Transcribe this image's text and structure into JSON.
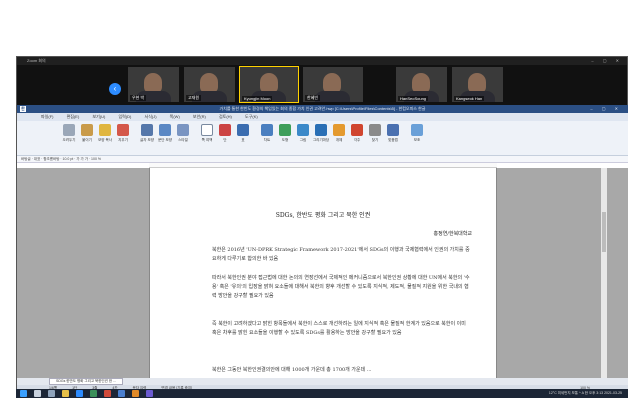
{
  "zoom": {
    "title": "Zoom 회의"
  },
  "gallery": {
    "participants": [
      {
        "name": "우현 박"
      },
      {
        "name": "고재원"
      },
      {
        "name": "Kyungjin Moon"
      },
      {
        "name": "한혜빈"
      },
      {
        "name": "HanSeoSoung"
      },
      {
        "name": "Kangseok Han"
      }
    ]
  },
  "hwp": {
    "title": "가치를 통한 한반도 환경의 책임있는 회의 종합 가치 인권 고려안.hwp [C:\\Users\\Profile\\Files\\Contents\\5] - 한컴오피스 한글",
    "menu": [
      "파일(F)",
      "편집(E)",
      "보기(U)",
      "입력(D)",
      "서식(J)",
      "쪽(W)",
      "보안(R)",
      "검토(H)",
      "도구(K)"
    ],
    "ribbon": [
      "오려두기",
      "붙이기",
      "모양 복사",
      "지우기",
      "글자 모양",
      "문단 모양",
      "스타일",
      "쪽 여백",
      "단",
      "표",
      "차트",
      "도형",
      "그림",
      "그리기마당",
      "개체",
      "각주",
      "찾기",
      "맞춤법",
      "보조"
    ],
    "format_bar": "바탕글  ·  대표  ·  함초롬바탕  ·  10.0 pt  ·  가  가  가  ·  100 %",
    "document": {
      "title": "SDGs, 한반도 평화 그리고 북한 인권",
      "author": "홍정연/한북대학교",
      "paragraphs": [
        "북한은 2016년 'UN-DPRK Strategic Framework 2017-2021'에서 SDGs의 이행과 국제협력에서 인권의 가치를 중요하게 다루기로 합의한 바 있음",
        "따라서 북한인권 분야 접근법에 대한 논의의 연장선에서 국제적인 메커니즘으로서 북한인권 상황에 대한 UN에서 북한의 '수용' 혹은 '유의'의 입장을 밝혀 요소들에 대해서 북한의 향후 개선할 수 있도록 지식적, 제도적, 물질적 지원을 위한 국내의 협력 방안을 강구할 필요가 있음",
        "즉 북한이 고려하겠다고 밝힌 항목들에서 북한이 스스로 개선하려는 일에 지식적 혹은 물질적 한계가 있음으로 북한이 이미 혹은 차후를 밝힌 요소들을 이행할 수 있도록 SDGs를 활용하는 방안을 강구할 필요가 있음",
        "북한은 그동안 북한인권결의안에 대해 1000개 가운데 총 1700개 가운데 ..."
      ]
    },
    "tab": "SDGs 한반도 평화 그리고 북한인권 한 ...",
    "status": [
      "1/6쪽",
      "1단",
      "3줄",
      "4칸",
      "문자 입력",
      "변경 내용 [기록 중지]"
    ],
    "zoom_level": "100 %"
  },
  "taskbar": {
    "tray": "12°C  미세먼지 보통  ^  A  한  오후 3:13  2021-03-25"
  }
}
